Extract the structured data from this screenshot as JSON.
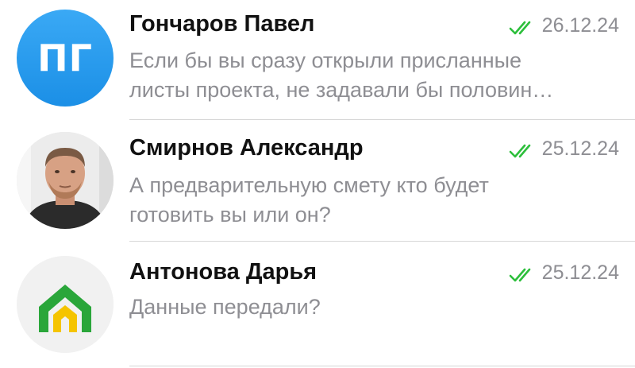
{
  "chats": [
    {
      "avatar_initials": "ПГ",
      "name": "Гончаров Павел",
      "date": "26.12.24",
      "status_icon": "double-check-icon",
      "preview_line1": "Если бы вы сразу открыли присланные",
      "preview_line2": "листы проекта, не задавали бы половин…"
    },
    {
      "avatar_icon": "user-photo",
      "name": "Смирнов Александр",
      "date": "25.12.24",
      "status_icon": "double-check-icon",
      "preview_line1": "А предварительную смету кто будет",
      "preview_line2": "готовить вы или он?"
    },
    {
      "avatar_icon": "house-logo",
      "name": "Антонова Дарья",
      "date": "25.12.24",
      "status_icon": "double-check-icon",
      "preview_line1": "Данные передали?"
    }
  ],
  "colors": {
    "accent_blue": "#2b9cf0",
    "read_check_green": "#2dbf3c",
    "secondary_text": "#8e8e93",
    "logo_green": "#2aa63a",
    "logo_yellow": "#f5c400"
  }
}
